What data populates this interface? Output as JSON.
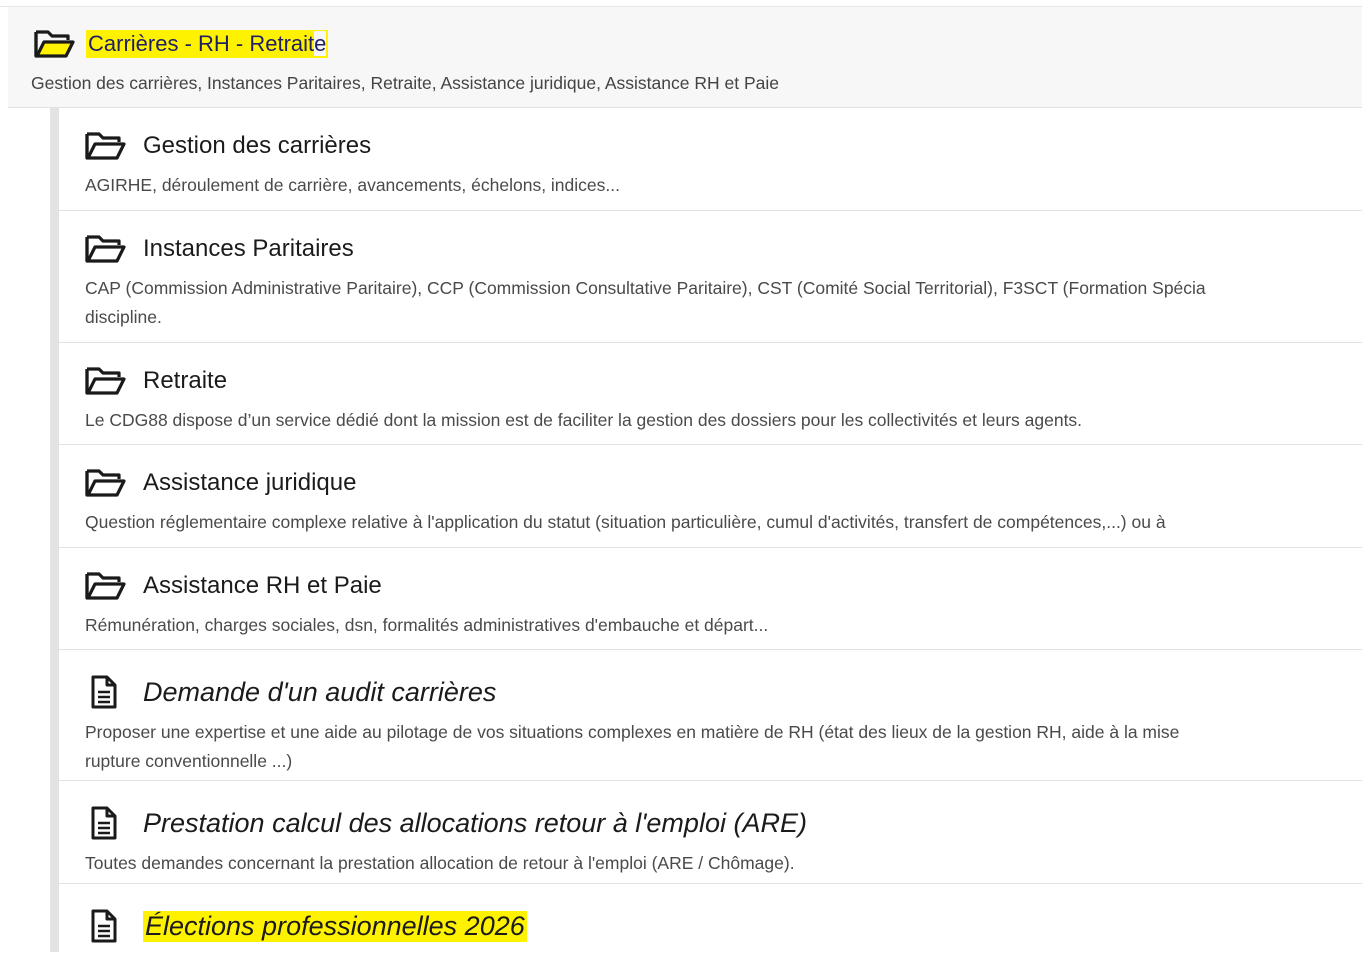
{
  "header": {
    "title_highlighted": "Carrières - RH - Retrait",
    "title_tail": "e",
    "description": "Gestion des carrières, Instances Paritaires, Retraite, Assistance juridique, Assistance RH et Paie",
    "icon": "folder-open-icon",
    "highlight_color": "#fff200",
    "title_color": "#1f1f66"
  },
  "items": [
    {
      "type": "folder",
      "icon": "folder-open-icon",
      "title": "Gestion des carrières",
      "desc_lines": [
        "AGIRHE, déroulement de carrière, avancements, échelons, indices..."
      ]
    },
    {
      "type": "folder",
      "icon": "folder-open-icon",
      "title": "Instances Paritaires",
      "desc_lines": [
        "CAP (Commission Administrative Paritaire), CCP (Commission Consultative Paritaire), CST (Comité Social Territorial), F3SCT (Formation Spécia",
        "discipline."
      ]
    },
    {
      "type": "folder",
      "icon": "folder-open-icon",
      "title": "Retraite",
      "desc_lines": [
        "Le CDG88 dispose d’un service dédié dont la mission est de faciliter la gestion des dossiers pour les collectivités et leurs agents."
      ]
    },
    {
      "type": "folder",
      "icon": "folder-open-icon",
      "title": "Assistance juridique",
      "desc_lines": [
        "Question réglementaire complexe relative à l'application du statut (situation particulière, cumul d'activités, transfert de compétences,...) ou à"
      ]
    },
    {
      "type": "folder",
      "icon": "folder-open-icon",
      "title": "Assistance RH et Paie",
      "desc_lines": [
        "Rémunération, charges sociales, dsn, formalités administratives d'embauche et départ..."
      ]
    },
    {
      "type": "document",
      "icon": "document-icon",
      "title": "Demande d'un audit carrières",
      "desc_lines": [
        "Proposer une expertise et une aide au pilotage de vos situations complexes en matière de RH (état des lieux de la gestion RH, aide à la mise",
        "rupture conventionnelle ...)"
      ]
    },
    {
      "type": "document",
      "icon": "document-icon",
      "title": "Prestation calcul des allocations retour à l'emploi (ARE)",
      "desc_lines": [
        "Toutes demandes concernant la prestation allocation de retour à l'emploi (ARE / Chômage)."
      ]
    },
    {
      "type": "document",
      "icon": "document-icon",
      "title": "Élections professionnelles 2026",
      "highlighted": true,
      "desc_lines": []
    }
  ]
}
